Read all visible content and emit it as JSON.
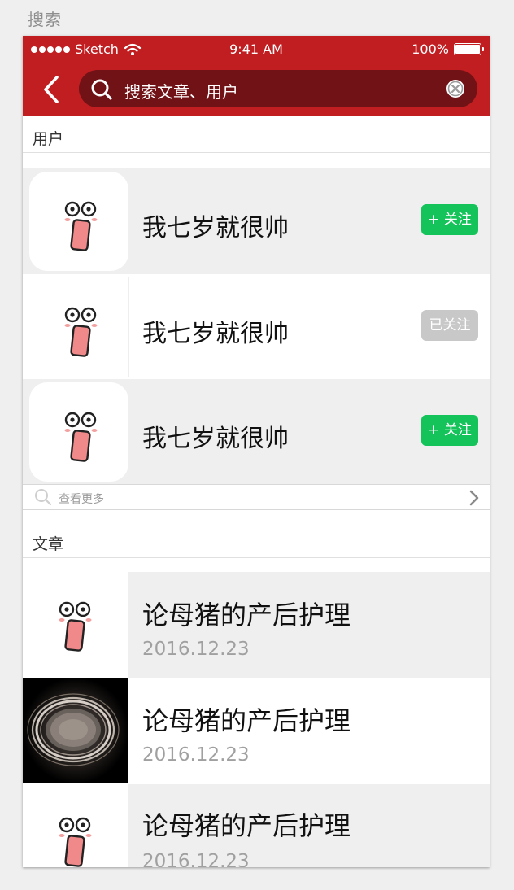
{
  "page_title": "搜索",
  "status_bar": {
    "carrier": "Sketch",
    "time": "9:41 AM",
    "battery": "100%"
  },
  "search": {
    "placeholder": "搜索文章、用户"
  },
  "icons": {
    "back": "chevron-left-icon",
    "search": "search-icon",
    "clear": "clear-icon",
    "wifi": "wifi-icon",
    "more": "chevron-right-icon"
  },
  "colors": {
    "header": "#c11e21",
    "search_bg": "#701216",
    "follow_green": "#14c35a",
    "followed_gray": "#c8c8c8"
  },
  "users_section": {
    "title": "用户",
    "items": [
      {
        "name": "我七岁就很帅",
        "button": "+ 关注",
        "followed": false
      },
      {
        "name": "我七岁就很帅",
        "button": "已关注",
        "followed": true
      },
      {
        "name": "我七岁就很帅",
        "button": "+ 关注",
        "followed": false
      }
    ],
    "see_more": "查看更多"
  },
  "articles_section": {
    "title": "文章",
    "items": [
      {
        "title": "论母猪的产后护理",
        "date": "2016.12.23"
      },
      {
        "title": "论母猪的产后护理",
        "date": "2016.12.23"
      },
      {
        "title": "论母猪的产后护理",
        "date": "2016.12.23"
      }
    ]
  }
}
